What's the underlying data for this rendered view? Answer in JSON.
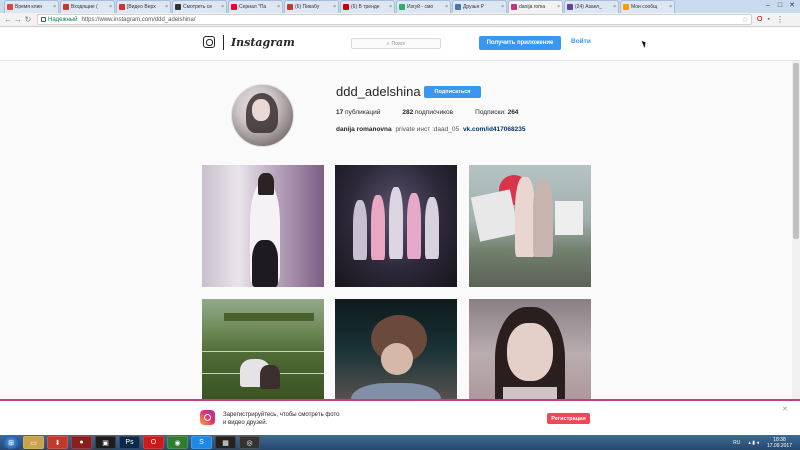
{
  "browser": {
    "tabs": [
      {
        "label": "Время клин",
        "color": "#d44"
      },
      {
        "label": "Входящие (",
        "color": "#c33"
      },
      {
        "label": "[Видео Верх",
        "color": "#c33"
      },
      {
        "label": "Смотреть се",
        "color": "#333"
      },
      {
        "label": "Сериал \"Па",
        "color": "#e03"
      },
      {
        "label": "(6) Пикабу",
        "color": "#c33"
      },
      {
        "label": "(6) В тренде",
        "color": "#c00"
      },
      {
        "label": "Изгуй - смо",
        "color": "#3a6"
      },
      {
        "label": "Друзья Р",
        "color": "#4a76a8"
      },
      {
        "label": "danija roma",
        "color": "#c13584"
      },
      {
        "label": "(24) Азаел_",
        "color": "#6441a4"
      },
      {
        "label": "Мои сообщ",
        "color": "#f90"
      }
    ],
    "active_tab": "danija roma",
    "secure_label": "Надежный",
    "url": "https://www.instagram.com/ddd_adelshina/",
    "window_controls": [
      "–",
      "□",
      "✕"
    ]
  },
  "header": {
    "logo_text": "Instagram",
    "search_placeholder": "Поиск",
    "get_app_label": "Получить приложение",
    "login_label": "Войти"
  },
  "profile": {
    "username": "ddd_adelshina",
    "follow_label": "Подписаться",
    "posts_count": "17",
    "posts_label": "публикаций",
    "followers_count": "282",
    "followers_label": "подписчиков",
    "following_label": "Подписки:",
    "following_count": "264",
    "full_name": "danija romanovna",
    "bio": "private инст :daad_05",
    "link": "vk.com/id417068235"
  },
  "banner": {
    "text": "Зарегистрируйтесь, чтобы смотреть фото и видео друзей.",
    "register_label": "Регистрация"
  },
  "taskbar": {
    "language": "RU",
    "time": "18:38",
    "date": "17.09.2017",
    "apps": [
      {
        "name": "folder",
        "glyph": "▭",
        "color": "#c9a24a"
      },
      {
        "name": "downloader",
        "glyph": "⬇",
        "color": "#c0392b"
      },
      {
        "name": "app-red",
        "glyph": "●",
        "color": "#8b1e1e"
      },
      {
        "name": "media",
        "glyph": "▣",
        "color": "#1c1c1c"
      },
      {
        "name": "photoshop",
        "glyph": "Ps",
        "color": "#0b2a4a"
      },
      {
        "name": "opera",
        "glyph": "O",
        "color": "#cc1a1a"
      },
      {
        "name": "chrome",
        "glyph": "◉",
        "color": "#2e7d32"
      },
      {
        "name": "skype",
        "glyph": "S",
        "color": "#1e88e5"
      },
      {
        "name": "app-dark",
        "glyph": "▦",
        "color": "#222"
      },
      {
        "name": "obs",
        "glyph": "◎",
        "color": "#333"
      }
    ]
  }
}
